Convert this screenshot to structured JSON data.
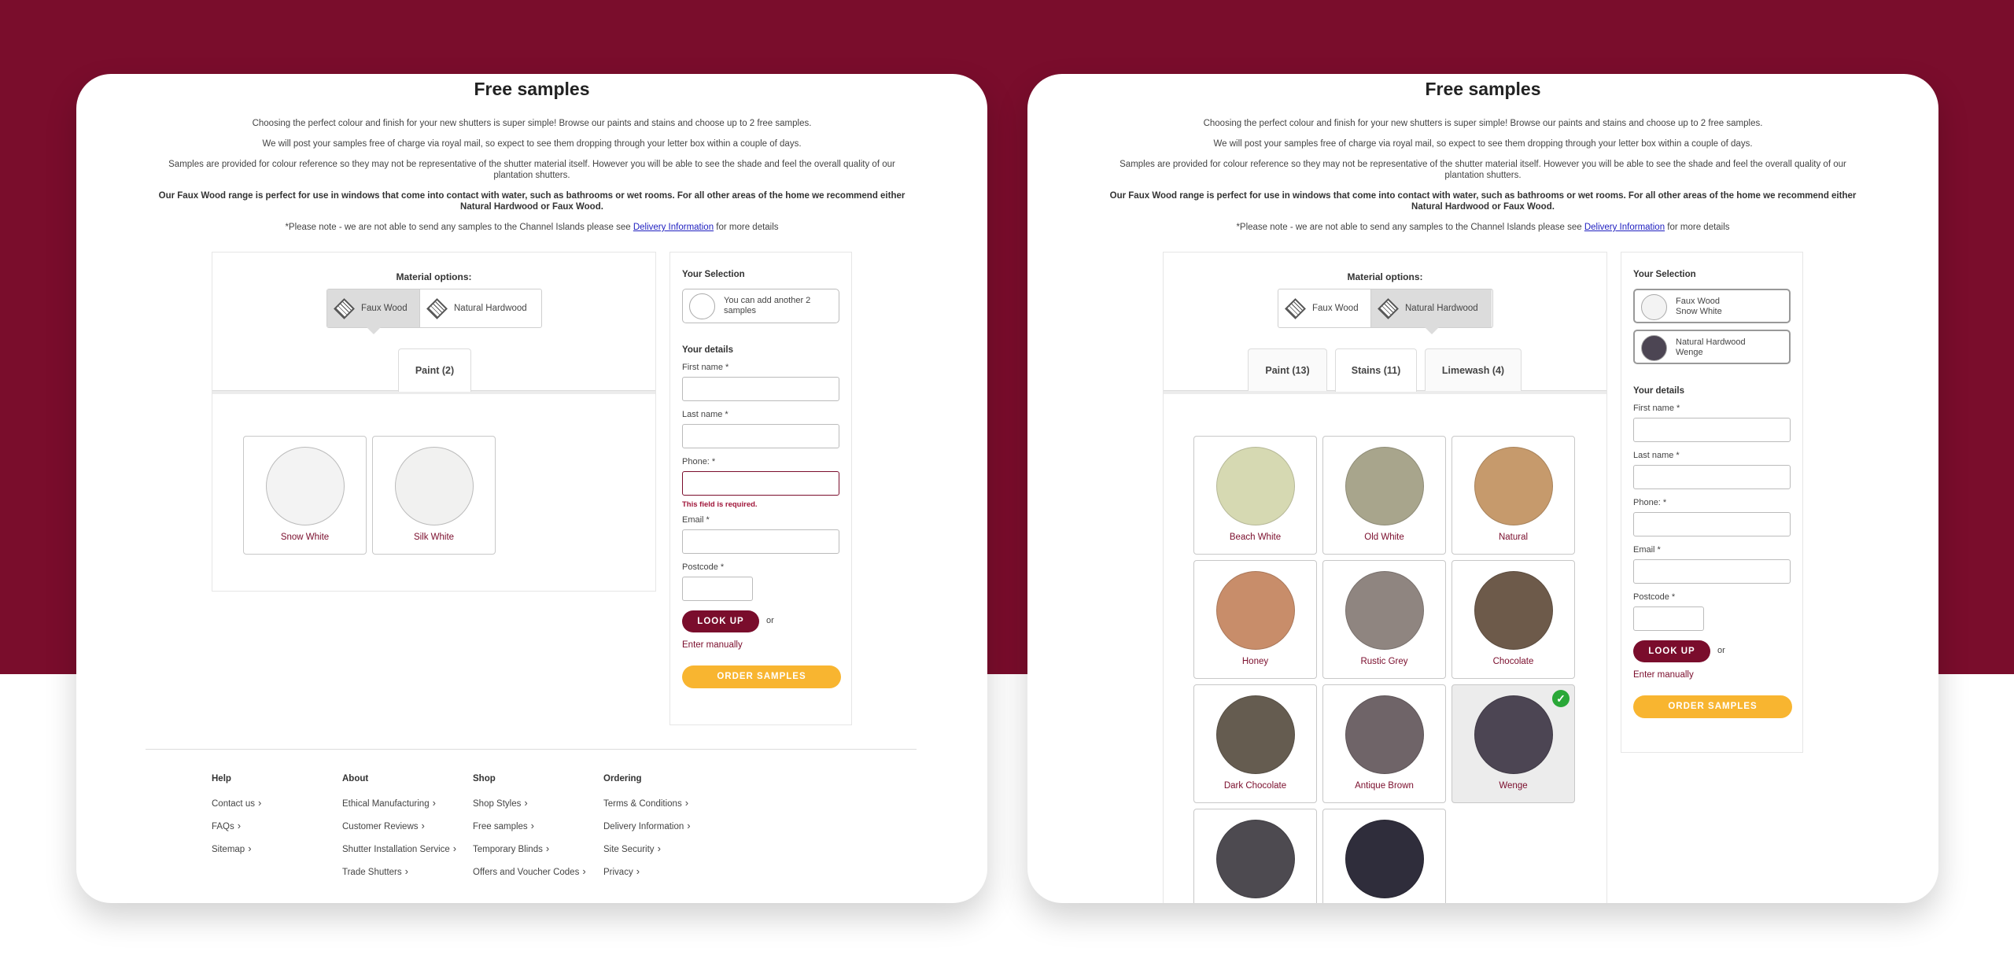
{
  "colors": {
    "brand": "#7a0d2c",
    "order_button": "#f8b530",
    "check": "#2aa838"
  },
  "left": {
    "title": "Free samples",
    "intro": [
      "Choosing the perfect colour and finish for your new shutters is super simple! Browse our paints and stains and choose up to 2 free samples.",
      "We will post your samples free of charge via royal mail, so expect to see them dropping through your letter box within a couple of days.",
      "Samples are provided for colour reference so they may not be representative of the shutter material itself. However you will be able to see the shade and feel the overall quality of our plantation shutters.",
      "Our Faux Wood range is perfect for use in windows that come into contact with water, such as bathrooms or wet rooms. For all other areas of the home we recommend either Natural Hardwood or Faux Wood."
    ],
    "note_pre": "*Please note - we are not able to send any samples to the Channel Islands please see ",
    "note_link": "Delivery Information",
    "note_post": " for more details",
    "material_label": "Material options:",
    "materials": [
      "Faux Wood",
      "Natural Hardwood"
    ],
    "active_material": "Faux Wood",
    "tabs": [
      "Paint (2)"
    ],
    "swatches": [
      {
        "name": "Snow White",
        "color": "#f3f3f3"
      },
      {
        "name": "Silk White",
        "color": "#f1f1f0"
      }
    ],
    "selection": {
      "heading": "Your Selection",
      "empty_text_1": "You can add another 2",
      "empty_text_2": "samples"
    },
    "details": {
      "heading": "Your details",
      "first_name": "First name *",
      "last_name": "Last name *",
      "phone": "Phone: *",
      "phone_error": "This field is required.",
      "email": "Email *",
      "postcode": "Postcode *",
      "lookup": "LOOK UP",
      "or": "or",
      "manual": "Enter manually",
      "order": "ORDER SAMPLES"
    },
    "footer": {
      "help": {
        "heading": "Help",
        "links": [
          "Contact us",
          "FAQs",
          "Sitemap"
        ]
      },
      "about": {
        "heading": "About",
        "links": [
          "Ethical Manufacturing",
          "Customer Reviews",
          "Shutter Installation Service",
          "Trade Shutters"
        ]
      },
      "shop": {
        "heading": "Shop",
        "links": [
          "Shop Styles",
          "Free samples",
          "Temporary Blinds",
          "Offers and Voucher Codes"
        ]
      },
      "ordering": {
        "heading": "Ordering",
        "links": [
          "Terms & Conditions",
          "Delivery Information",
          "Site Security",
          "Privacy"
        ]
      }
    }
  },
  "right": {
    "title": "Free samples",
    "material_label": "Material options:",
    "materials": [
      "Faux Wood",
      "Natural Hardwood"
    ],
    "active_material": "Natural Hardwood",
    "tabs": [
      "Paint (13)",
      "Stains (11)",
      "Limewash (4)"
    ],
    "active_tab": "Stains (11)",
    "swatches": [
      {
        "name": "Beach White",
        "color": "#d6d9b2"
      },
      {
        "name": "Old White",
        "color": "#a8a58c"
      },
      {
        "name": "Natural",
        "color": "#c69a6c"
      },
      {
        "name": "Honey",
        "color": "#c88d6a"
      },
      {
        "name": "Rustic Grey",
        "color": "#8f8580"
      },
      {
        "name": "Chocolate",
        "color": "#6d5a4a"
      },
      {
        "name": "Dark Chocolate",
        "color": "#655c50"
      },
      {
        "name": "Antique Brown",
        "color": "#6f6468"
      },
      {
        "name": "Wenge",
        "color": "#4c4553",
        "selected": true
      },
      {
        "name": "",
        "color": "#4d4a50"
      },
      {
        "name": "",
        "color": "#2f2d3b"
      }
    ],
    "selection": {
      "heading": "Your Selection",
      "items": [
        {
          "line1": "Faux Wood",
          "line2": "Snow White",
          "color": "#f3f3f3"
        },
        {
          "line1": "Natural Hardwood",
          "line2": "Wenge",
          "color": "#4c4553"
        }
      ]
    },
    "details": {
      "heading": "Your details",
      "first_name": "First name *",
      "last_name": "Last name *",
      "phone": "Phone: *",
      "email": "Email *",
      "postcode": "Postcode *",
      "lookup": "LOOK UP",
      "or": "or",
      "manual": "Enter manually",
      "order": "ORDER SAMPLES"
    }
  }
}
